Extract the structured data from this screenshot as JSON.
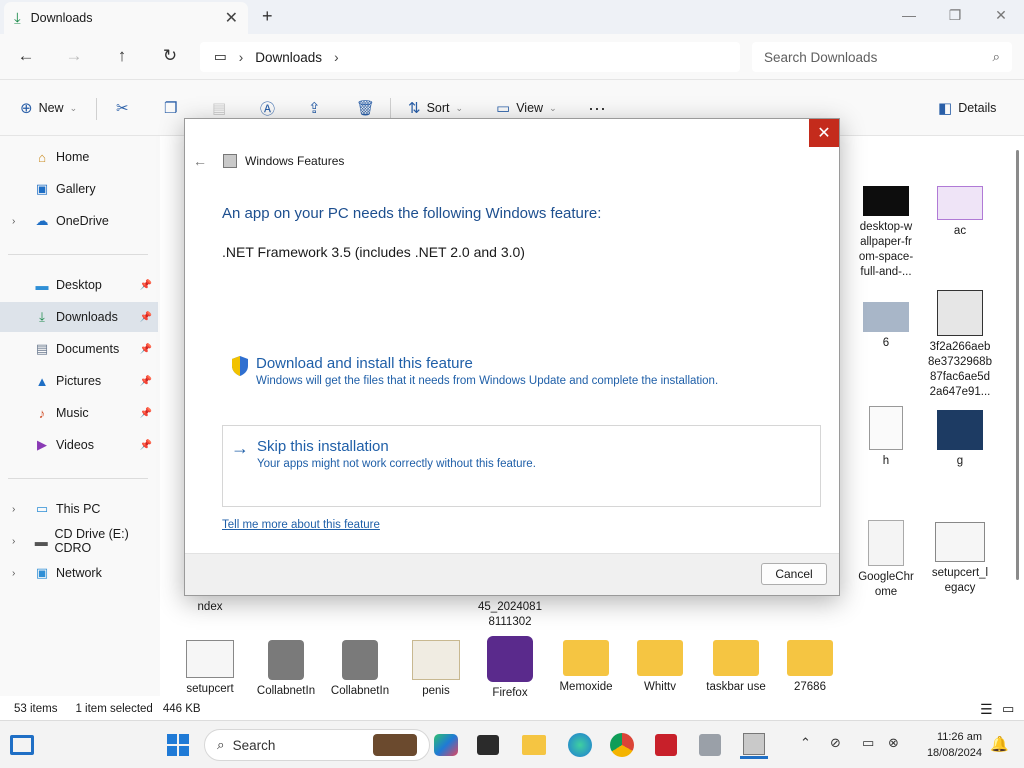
{
  "window": {
    "tab_title": "Downloads",
    "address_segment": "Downloads",
    "search_placeholder": "Search Downloads"
  },
  "toolbar": {
    "new_label": "New",
    "sort_label": "Sort",
    "view_label": "View",
    "details_label": "Details"
  },
  "sidebar": {
    "home": "Home",
    "gallery": "Gallery",
    "onedrive": "OneDrive",
    "desktop": "Desktop",
    "downloads": "Downloads",
    "documents": "Documents",
    "pictures": "Pictures",
    "music": "Music",
    "videos": "Videos",
    "this_pc": "This PC",
    "cd_drive": "CD Drive (E:) CDRO",
    "network": "Network"
  },
  "files": {
    "desktop_wallpaper": "desktop-w allpaper-fr om-space- full-and-...",
    "ac": "ac",
    "six": "6",
    "hash_file": "3f2a266aeb 8e3732968b 87fac6ae5d 2a647e91...",
    "h": "h",
    "g": "g",
    "googlechrome": "GoogleChr ome",
    "setupcert_legacy": "setupcert_l egacy",
    "ndex": "ndex",
    "dated_file": "45_2024081 8111302",
    "setupcert": "setupcert",
    "collabnet1": "CollabnetIn",
    "collabnet2": "CollabnetIn",
    "penis": "penis",
    "firefox": "Firefox",
    "memoxide": "Memoxide",
    "whitty": "Whittv",
    "taskbar_use": "taskbar use",
    "n27686": "27686"
  },
  "status": {
    "items_count": "53 items",
    "selection": "1 item selected",
    "size": "446 KB"
  },
  "dialog": {
    "title": "Windows Features",
    "heading": "An app on your PC needs the following Windows feature:",
    "feature_name": ".NET Framework 3.5 (includes .NET 2.0 and 3.0)",
    "option1_title": "Download and install this feature",
    "option1_desc": "Windows will get the files that it needs from Windows Update and complete the installation.",
    "option2_title": "Skip this installation",
    "option2_desc": "Your apps might not work correctly without this feature.",
    "link_text": "Tell me more about this feature",
    "cancel_label": "Cancel"
  },
  "taskbar": {
    "search_label": "Search",
    "time": "11:26 am",
    "date": "18/08/2024"
  },
  "colors": {
    "accent": "#1f5fa8",
    "close_red": "#c42b1c",
    "folder_yellow": "#f5c542"
  }
}
